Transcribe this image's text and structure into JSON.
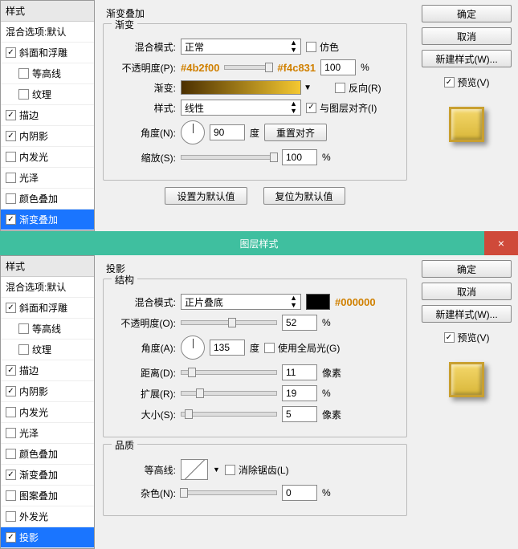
{
  "top": {
    "style_header": "样式",
    "blend_options": "混合选项:默认",
    "items": [
      {
        "label": "斜面和浮雕",
        "checked": true,
        "sub": false
      },
      {
        "label": "等高线",
        "checked": false,
        "sub": true
      },
      {
        "label": "纹理",
        "checked": false,
        "sub": true
      },
      {
        "label": "描边",
        "checked": true,
        "sub": false
      },
      {
        "label": "内阴影",
        "checked": true,
        "sub": false
      },
      {
        "label": "内发光",
        "checked": false,
        "sub": false
      },
      {
        "label": "光泽",
        "checked": false,
        "sub": false
      },
      {
        "label": "颜色叠加",
        "checked": false,
        "sub": false
      },
      {
        "label": "渐变叠加",
        "checked": true,
        "sub": false,
        "active": true
      }
    ],
    "section_title": "渐变叠加",
    "legend": "渐变",
    "blend_mode_label": "混合模式:",
    "blend_mode_value": "正常",
    "dither_label": "仿色",
    "opacity_label": "不透明度(P):",
    "opacity_value": "100",
    "opacity_unit": "%",
    "hex_left": "#4b2f00",
    "grad_label": "渐变:",
    "hex_right": "#f4c831",
    "reverse_label": "反向(R)",
    "style_label": "样式:",
    "style_value": "线性",
    "align_label": "与图层对齐(I)",
    "angle_label": "角度(N):",
    "angle_value": "90",
    "angle_unit": "度",
    "reset_align": "重置对齐",
    "scale_label": "缩放(S):",
    "scale_value": "100",
    "scale_unit": "%",
    "make_default": "设置为默认值",
    "reset_default": "复位为默认值",
    "ok": "确定",
    "cancel": "取消",
    "new_style": "新建样式(W)...",
    "preview_label": "预览(V)"
  },
  "titlebar": {
    "title": "图层样式",
    "close": "×"
  },
  "bottom": {
    "style_header": "样式",
    "blend_options": "混合选项:默认",
    "items": [
      {
        "label": "斜面和浮雕",
        "checked": true,
        "sub": false
      },
      {
        "label": "等高线",
        "checked": false,
        "sub": true
      },
      {
        "label": "纹理",
        "checked": false,
        "sub": true
      },
      {
        "label": "描边",
        "checked": true,
        "sub": false
      },
      {
        "label": "内阴影",
        "checked": true,
        "sub": false
      },
      {
        "label": "内发光",
        "checked": false,
        "sub": false
      },
      {
        "label": "光泽",
        "checked": false,
        "sub": false
      },
      {
        "label": "颜色叠加",
        "checked": false,
        "sub": false
      },
      {
        "label": "渐变叠加",
        "checked": true,
        "sub": false
      },
      {
        "label": "图案叠加",
        "checked": false,
        "sub": false
      },
      {
        "label": "外发光",
        "checked": false,
        "sub": false
      },
      {
        "label": "投影",
        "checked": true,
        "sub": false,
        "active": true
      }
    ],
    "section_title": "投影",
    "legend1": "结构",
    "blend_mode_label": "混合模式:",
    "blend_mode_value": "正片叠底",
    "hex_color": "#000000",
    "opacity_label": "不透明度(O):",
    "opacity_value": "52",
    "opacity_unit": "%",
    "angle_label": "角度(A):",
    "angle_value": "135",
    "angle_unit": "度",
    "global_light_label": "使用全局光(G)",
    "distance_label": "距离(D):",
    "distance_value": "11",
    "distance_unit": "像素",
    "spread_label": "扩展(R):",
    "spread_value": "19",
    "spread_unit": "%",
    "size_label": "大小(S):",
    "size_value": "5",
    "size_unit": "像素",
    "legend2": "品质",
    "contour_label": "等高线:",
    "antialias_label": "消除锯齿(L)",
    "noise_label": "杂色(N):",
    "noise_value": "0",
    "noise_unit": "%",
    "ok": "确定",
    "cancel": "取消",
    "new_style": "新建样式(W)...",
    "preview_label": "预览(V)"
  }
}
